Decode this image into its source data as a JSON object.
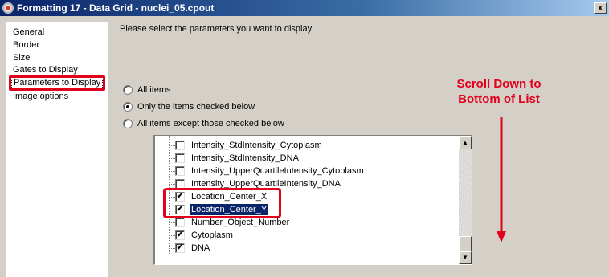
{
  "window": {
    "title": "Formatting 17 - Data Grid - nuclei_05.cpout",
    "close_glyph": "x"
  },
  "nav": {
    "items": [
      {
        "label": "General"
      },
      {
        "label": "Border"
      },
      {
        "label": "Size"
      },
      {
        "label": "Gates to Display"
      },
      {
        "label": "Parameters to Display"
      },
      {
        "label": "Image options"
      }
    ],
    "selected_index": 4
  },
  "main": {
    "prompt": "Please select the parameters you want to display",
    "radio_options": [
      {
        "label": "All items",
        "selected": false
      },
      {
        "label": "Only the items checked below",
        "selected": true
      },
      {
        "label": "All items except those checked below",
        "selected": false
      }
    ],
    "list": {
      "items": [
        {
          "label": "Intensity_StdIntensity_Cytoplasm",
          "checked": false
        },
        {
          "label": "Intensity_StdIntensity_DNA",
          "checked": false
        },
        {
          "label": "Intensity_UpperQuartileIntensity_Cytoplasm",
          "checked": false
        },
        {
          "label": "Intensity_UpperQuartileIntensity_DNA",
          "checked": false
        },
        {
          "label": "Location_Center_X",
          "checked": true
        },
        {
          "label": "Location_Center_Y",
          "checked": true,
          "selected": true
        },
        {
          "label": "Number_Object_Number",
          "checked": false
        },
        {
          "label": "Cytoplasm",
          "checked": true
        },
        {
          "label": "DNA",
          "checked": true
        }
      ],
      "check_glyph": "✔",
      "scroll_up_glyph": "▲",
      "scroll_down_glyph": "▼"
    }
  },
  "annotation": {
    "line1": "Scroll Down to",
    "line2": "Bottom of List",
    "color": "#e3001b"
  },
  "colors": {
    "titlebar_start": "#0a246a",
    "titlebar_end": "#a6caf0",
    "dialog_bg": "#d4d0c8",
    "highlight_red": "#e3001b",
    "selection_bg": "#0a246a"
  }
}
